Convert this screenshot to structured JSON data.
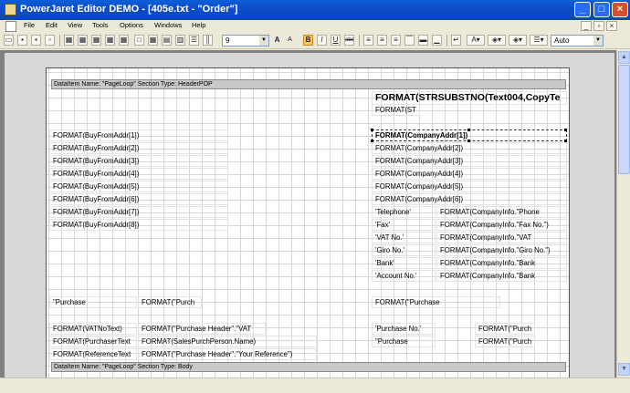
{
  "titlebar": {
    "title": "PowerJaret Editor DEMO - [405e.txt - \"Order\"]",
    "minimize_label": "_",
    "maximize_label": "□",
    "close_label": "×"
  },
  "menubar": {
    "items": [
      "File",
      "Edit",
      "View",
      "Tools",
      "Options",
      "Windows",
      "Help"
    ],
    "doc_controls": [
      "_",
      "▫",
      "×"
    ]
  },
  "toolbar": {
    "font_size_value": "9",
    "bold_label": "B",
    "italic_label": "I",
    "underline_label": "U",
    "strike_label": "abc",
    "color_value": "Auto",
    "grow_font_label": "A",
    "shrink_font_label": "A"
  },
  "sections": [
    {
      "label": "DataItem Name: \"PageLoop\"   Section Type: HeaderPOP"
    },
    {
      "label": "DataItem Name: \"PageLoop\"   Section Type: Body"
    }
  ],
  "cells": {
    "title_big": "FORMAT(STRSUBSTNO(Text004,CopyTe",
    "title_small": "FORMAT(ST",
    "buy_from": [
      "FORMAT(BuyFromAddr[1])",
      "FORMAT(BuyFromAddr[2])",
      "FORMAT(BuyFromAddr[3])",
      "FORMAT(BuyFromAddr[4])",
      "FORMAT(BuyFromAddr[5])",
      "FORMAT(BuyFromAddr[6])",
      "FORMAT(BuyFromAddr[7])",
      "FORMAT(BuyFromAddr[8])"
    ],
    "company_addr": [
      "FORMAT(CompanyAddr[1])",
      "FORMAT(CompanyAddr[2])",
      "FORMAT(CompanyAddr[3])",
      "FORMAT(CompanyAddr[4])",
      "FORMAT(CompanyAddr[5])",
      "FORMAT(CompanyAddr[6])"
    ],
    "info_labels": [
      "'Telephone'",
      "'Fax'",
      "'VAT No.'",
      "'Giro No.'",
      "'Bank'",
      "'Account No.'"
    ],
    "info_values": [
      "FORMAT(CompanyInfo.\"Phone",
      "FORMAT(CompanyInfo.\"Fax No.\")",
      "FORMAT(CompanyInfo.\"VAT",
      "FORMAT(CompanyInfo.\"Giro No.\")",
      "FORMAT(CompanyInfo.\"Bank",
      "FORMAT(CompanyInfo.\"Bank"
    ],
    "purchase_label": "\"Purchase",
    "purchase_format": "FORMAT(\"Purch",
    "purchase_right": "FORMAT(\"Purchase",
    "vat_no_text": "FORMAT(VATNoText)",
    "purchaser_text": "FORMAT(PurchaserText",
    "reference_text": "FORMAT(ReferenceText",
    "purch_header_vat": "FORMAT(\"Purchase Header\".\"VAT",
    "salesperson": "FORMAT(SalesPurchPerson.Name)",
    "your_reference": "FORMAT(\"Purchase Header\".\"Your Reference\")",
    "purchase_no_label": "'Purchase No.'",
    "purchase_label2": "\"Purchase",
    "purch_right1": "FORMAT(\"Purch",
    "purch_right2": "FORMAT(\"Purch"
  }
}
